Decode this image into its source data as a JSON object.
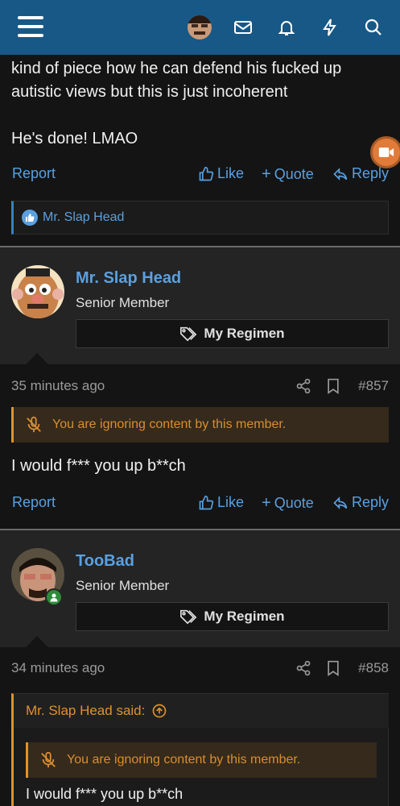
{
  "header": {
    "menu_icon": "hamburger-menu-icon",
    "avatar_icon": "user-avatar",
    "icons": [
      "mail-icon",
      "bell-icon",
      "bolt-icon",
      "search-icon"
    ]
  },
  "previous_post": {
    "lines": [
      "kind of piece how he can defend his fucked up",
      "autistic views but this is just incoherent",
      "He's done! LMAO"
    ],
    "actions": {
      "report": "Report",
      "like": "Like",
      "quote": "Quote",
      "reply": "Reply"
    },
    "reactions": "Mr. Slap Head"
  },
  "posts": [
    {
      "username": "Mr. Slap Head",
      "title": "Senior Member",
      "regimen": "My Regimen",
      "time": "35 minutes ago",
      "number": "#857",
      "ignore_notice": "You are ignoring content by this member.",
      "body": "I would f*** you up b**ch",
      "actions": {
        "report": "Report",
        "like": "Like",
        "quote": "Quote",
        "reply": "Reply"
      }
    },
    {
      "username": "TooBad",
      "title": "Senior Member",
      "regimen": "My Regimen",
      "time": "34 minutes ago",
      "number": "#858",
      "quote": {
        "header": "Mr. Slap Head said:",
        "ignore_notice": "You are ignoring content by this member.",
        "body": "I would f*** you up b**ch"
      }
    }
  ],
  "colors": {
    "topbar": "#185886",
    "link": "#5aa0e0",
    "warning": "#e0922a",
    "background": "#141414"
  }
}
